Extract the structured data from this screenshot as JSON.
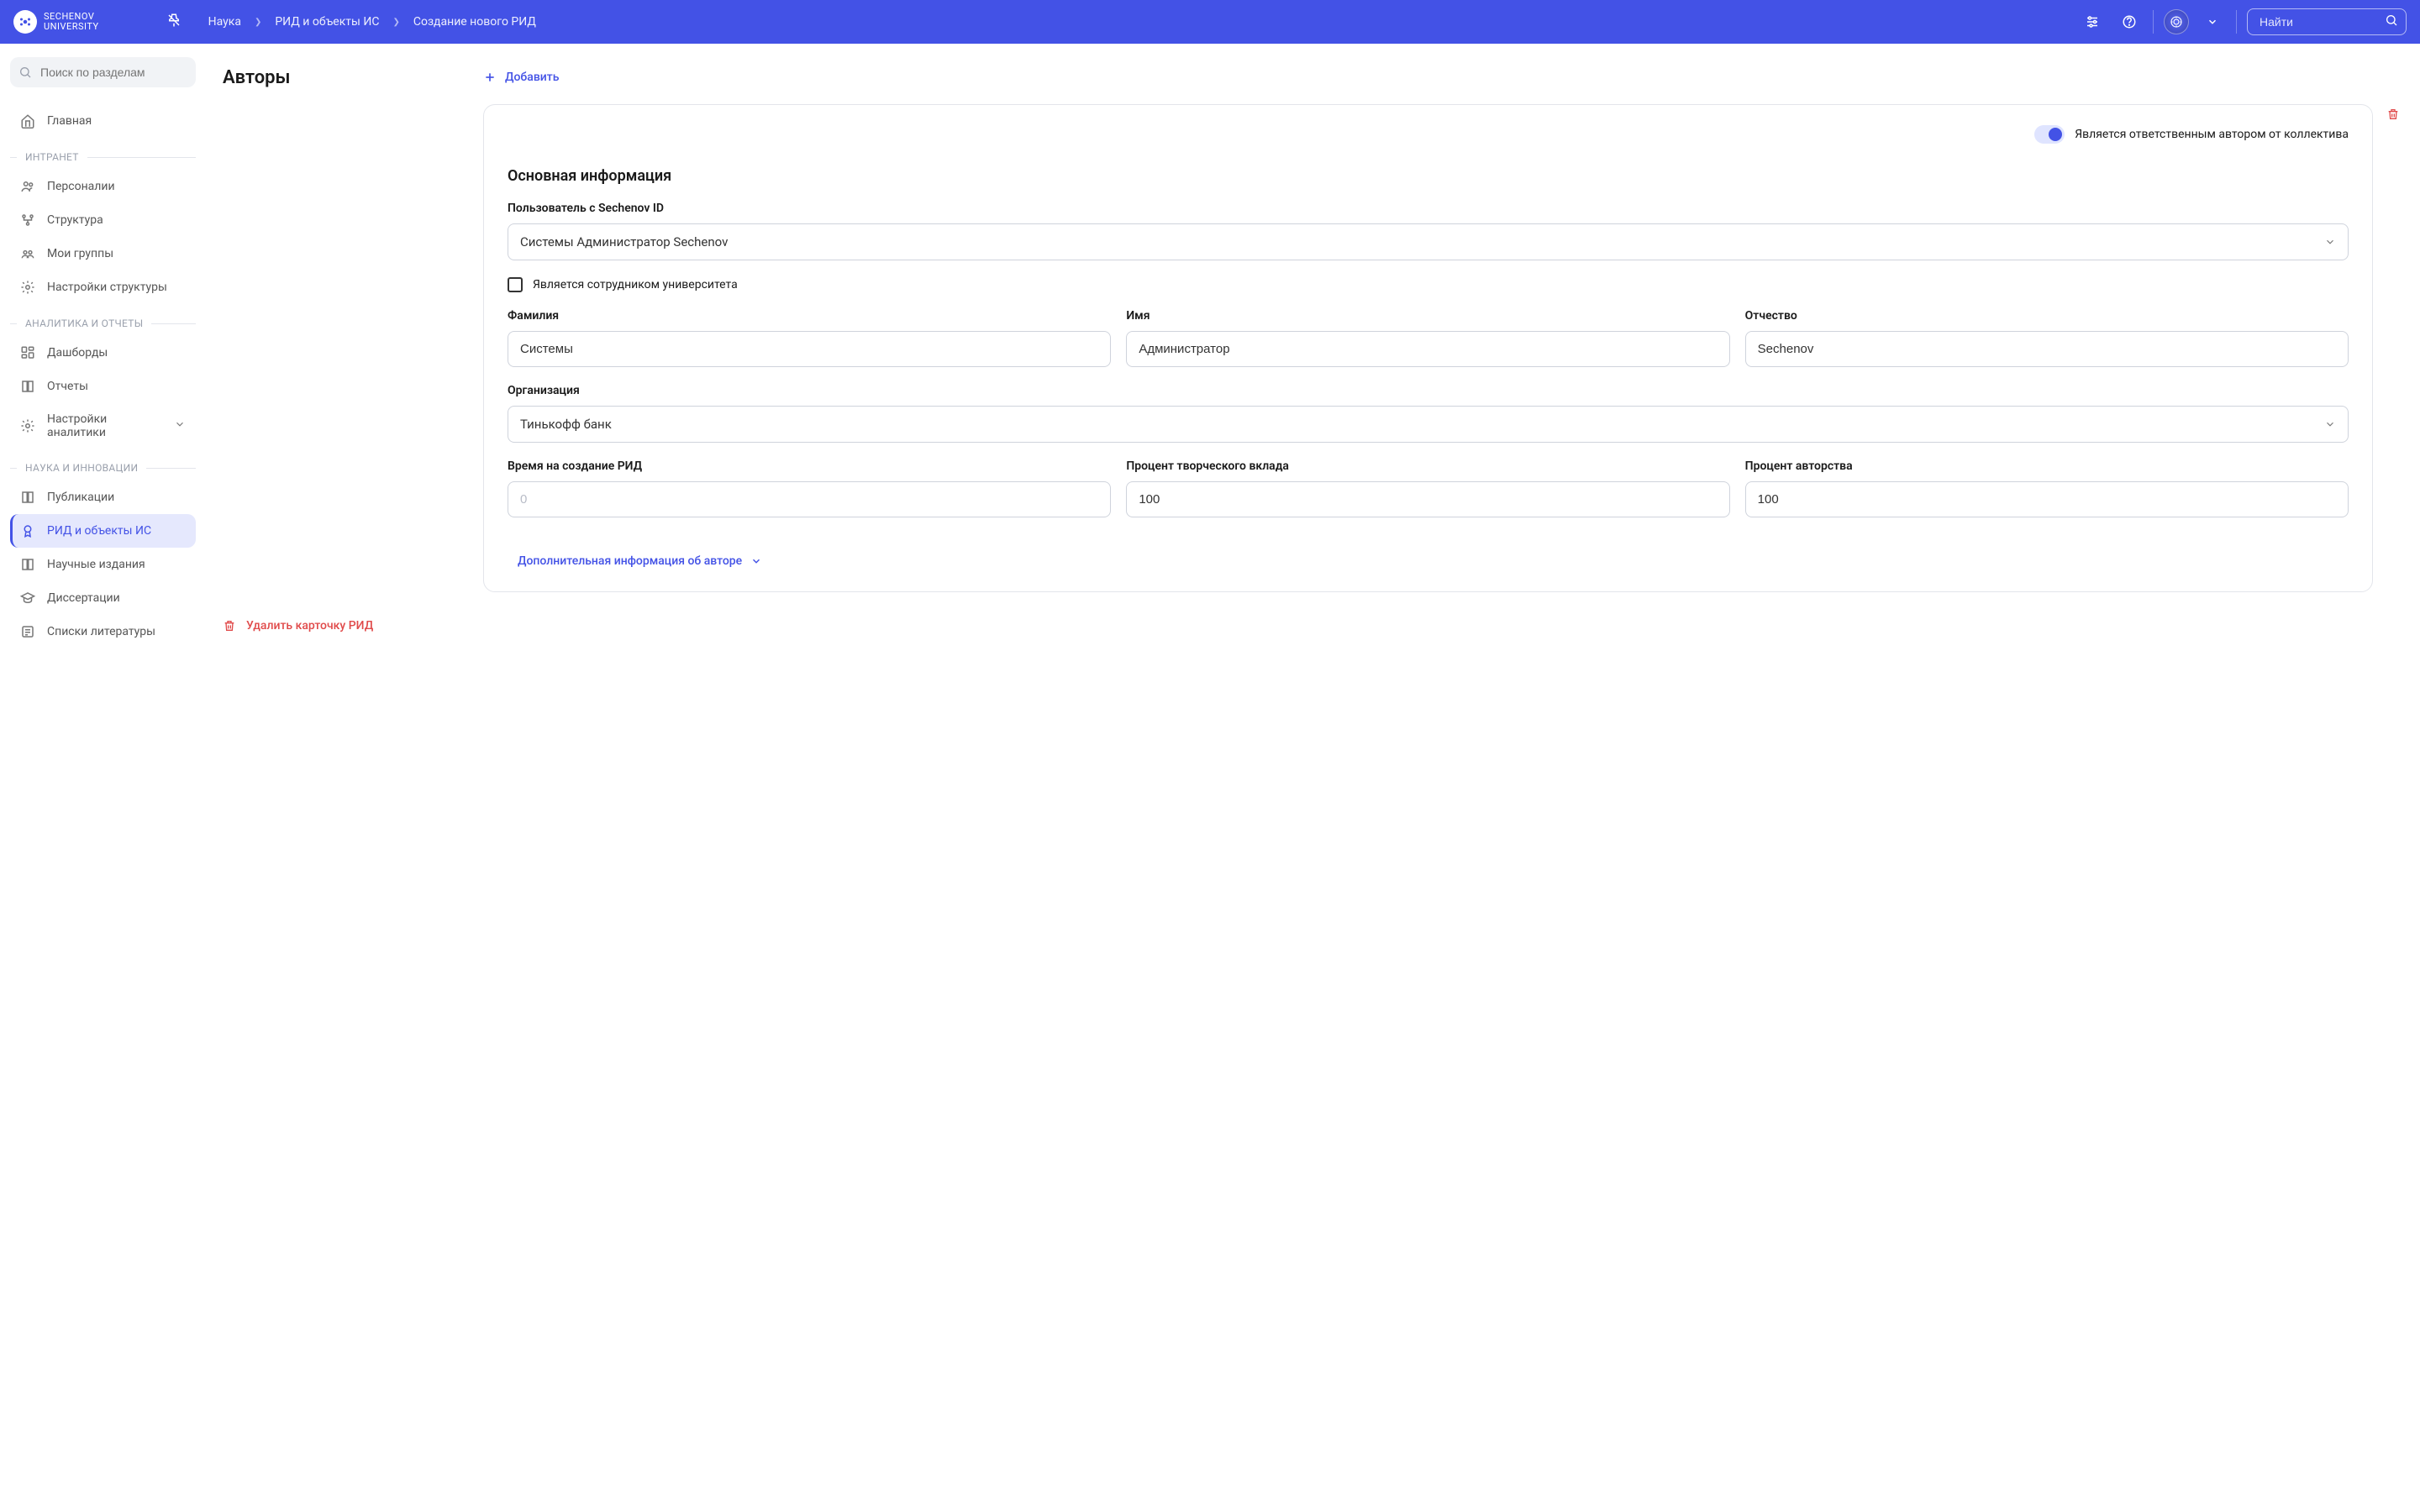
{
  "header": {
    "logo_line1": "SECHENOV",
    "logo_line2": "UNIVERSITY",
    "breadcrumb": [
      "Наука",
      "РИД и объекты ИС",
      "Создание нового РИД"
    ],
    "search_placeholder": "Найти"
  },
  "sidebar": {
    "search_placeholder": "Поиск по разделам",
    "home": "Главная",
    "sections": [
      {
        "title": "ИНТРАНЕТ",
        "items": [
          "Персоналии",
          "Структура",
          "Мои группы",
          "Настройки структуры"
        ]
      },
      {
        "title": "АНАЛИТИКА И ОТЧЕТЫ",
        "items": [
          "Дашборды",
          "Отчеты",
          "Настройки аналитики"
        ]
      },
      {
        "title": "НАУКА И ИННОВАЦИИ",
        "items": [
          "Публикации",
          "РИД и объекты ИС",
          "Научные издания",
          "Диссертации",
          "Списки литературы"
        ]
      }
    ]
  },
  "main": {
    "section_title": "Авторы",
    "add_button": "Добавить",
    "toggle_label": "Является ответственным автором от коллектива",
    "sub_heading": "Основная информация",
    "user_label": "Пользователь с Sechenov ID",
    "user_value": "Системы Администратор Sechenov",
    "checkbox_label": "Является сотрудником университета",
    "lastname_label": "Фамилия",
    "lastname_value": "Системы",
    "firstname_label": "Имя",
    "firstname_value": "Администратор",
    "middlename_label": "Отчество",
    "middlename_value": "Sechenov",
    "org_label": "Организация",
    "org_value": "Тинькофф банк",
    "time_label": "Время на создание РИД",
    "time_placeholder": "0",
    "percent_creative_label": "Процент творческого вклада",
    "percent_creative_value": "100",
    "percent_author_label": "Процент авторства",
    "percent_author_value": "100",
    "expand_link": "Дополнительная информация об авторе",
    "delete_link": "Удалить карточку РИД"
  }
}
